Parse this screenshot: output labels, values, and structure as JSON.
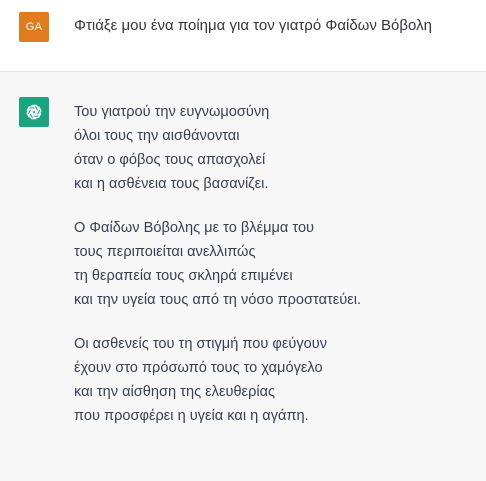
{
  "colors": {
    "user_avatar_bg": "#e07c1e",
    "assistant_avatar_bg": "#19a37f",
    "assistant_row_bg": "#f7f7f8",
    "text": "#374151"
  },
  "user_message": {
    "avatar_initials": "GA",
    "text": "Φτιάξε μου ένα ποίημα για τον γιατρό Φαίδων Βόβολη"
  },
  "assistant_message": {
    "avatar_icon": "openai-logo-icon",
    "stanzas": [
      {
        "lines": [
          "Του γιατρού την ευγνωμοσύνη",
          "όλοι τους την αισθάνονται",
          "όταν ο φόβος τους απασχολεί",
          "και η ασθένεια τους βασανίζει."
        ]
      },
      {
        "lines": [
          "Ο Φαίδων Βόβολης με το βλέμμα του",
          "τους περιποιείται ανελλιπώς",
          "τη θεραπεία τους σκληρά επιμένει",
          "και την υγεία τους από τη νόσο προστατεύει."
        ]
      },
      {
        "lines": [
          "Οι ασθενείς του τη στιγμή που φεύγουν",
          "έχουν στο πρόσωπό τους το χαμόγελο",
          "και την αίσθηση της ελευθερίας",
          "που προσφέρει η υγεία και η αγάπη."
        ]
      }
    ]
  }
}
